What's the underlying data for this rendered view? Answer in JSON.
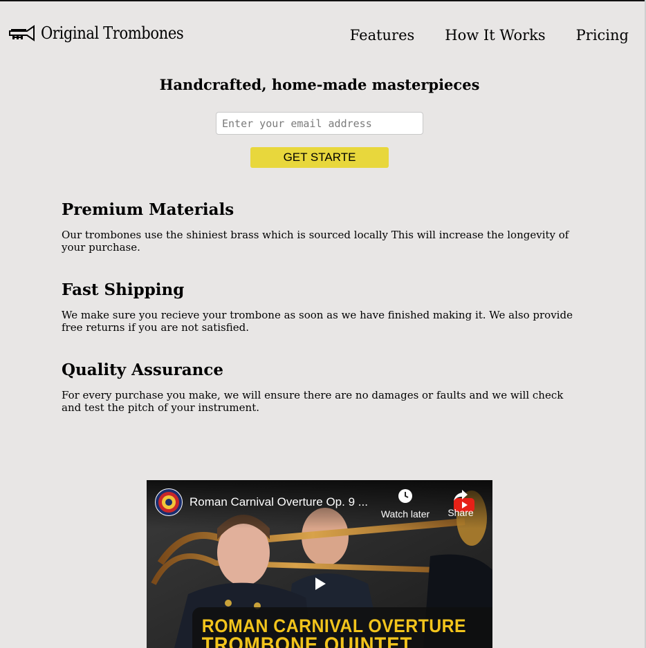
{
  "brand": {
    "name": "Original Trombones",
    "logo_icon": "trumpet-icon"
  },
  "nav": {
    "items": [
      {
        "label": "Features"
      },
      {
        "label": "How It Works"
      },
      {
        "label": "Pricing"
      }
    ]
  },
  "hero": {
    "title": "Handcrafted, home-made masterpieces",
    "email_placeholder": "Enter your email address",
    "cta_label": "GET STARTE",
    "cta_color": "#e8d73c"
  },
  "features": [
    {
      "title": "Premium Materials",
      "text": "Our trombones use the shiniest brass which is sourced locally This will increase the longevity of your purchase."
    },
    {
      "title": "Fast Shipping",
      "text": "We make sure you recieve your trombone as soon as we have finished making it. We also provide free returns if you are not satisfied."
    },
    {
      "title": "Quality Assurance",
      "text": "For every purchase you make, we will ensure there are no damages or faults and we will check and test the pitch of your instrument."
    }
  ],
  "video": {
    "title": "Roman Carnival Overture Op. 9 ...",
    "watch_later_label": "Watch later",
    "share_label": "Share",
    "banner_line1": "ROMAN CARNIVAL OVERTURE",
    "banner_line2": "TROMBONE QUINTET",
    "banner_color": "#f2c41c"
  }
}
